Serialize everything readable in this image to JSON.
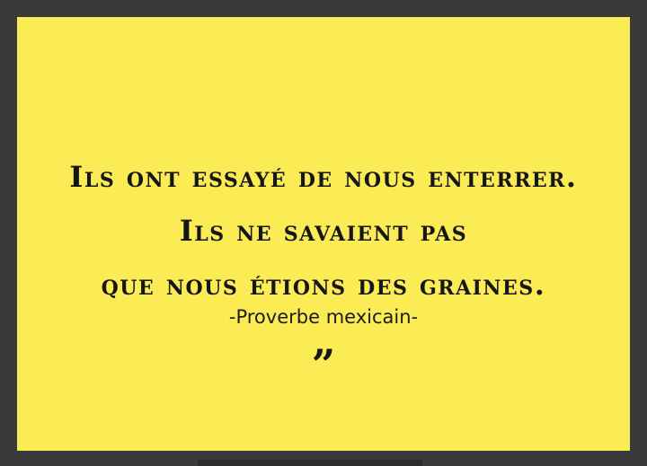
{
  "quote": {
    "line1": "Ils ont essayé de nous enterrer.",
    "line2": "Ils ne savaient pas",
    "line3": "que nous étions des graines.",
    "attribution": "-Proverbe mexicain-",
    "closing_mark": "”"
  },
  "colors": {
    "background": "#3a3a3a",
    "card": "#fbeb55",
    "text": "#161616"
  }
}
